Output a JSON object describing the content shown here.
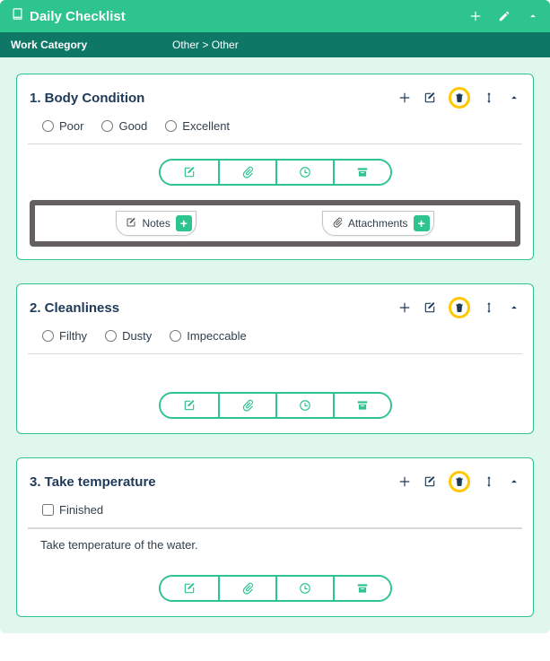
{
  "titlebar": {
    "title": "Daily Checklist"
  },
  "subheader": {
    "left": "Work Category",
    "right": "Other > Other"
  },
  "cards": [
    {
      "title": "1. Body Condition",
      "type": "radio",
      "options": [
        "Poor",
        "Good",
        "Excellent"
      ],
      "notesLabel": "Notes",
      "attachLabel": "Attachments",
      "showNotesAttach": true
    },
    {
      "title": "2. Cleanliness",
      "type": "radio",
      "options": [
        "Filthy",
        "Dusty",
        "Impeccable"
      ],
      "showNotesAttach": false
    },
    {
      "title": "3. Take temperature",
      "type": "checkbox",
      "options": [
        "Finished"
      ],
      "description": "Take temperature of the water.",
      "showNotesAttach": false
    }
  ]
}
